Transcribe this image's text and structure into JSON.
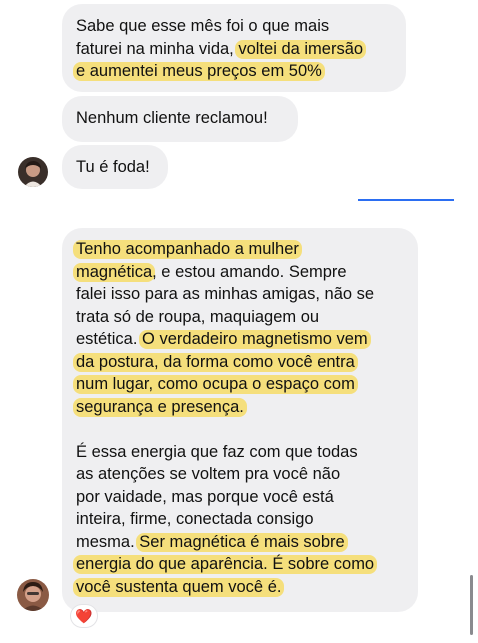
{
  "conversation": {
    "messages_top": [
      {
        "lines": [
          [
            "Sabe que esse mês foi o que mais"
          ],
          [
            "faturei na minha vida, ",
            "voltei da imersão"
          ],
          [
            "e aumentei meus preços em 50%"
          ]
        ]
      },
      {
        "lines": [
          [
            "Nenhum cliente reclamou!"
          ]
        ]
      },
      {
        "lines": [
          [
            "Tu é foda!"
          ]
        ]
      }
    ],
    "long_message": {
      "para1": [
        "Tenho acompanhado a mulher",
        "magnética",
        ", e estou amando. Sempre",
        "falei isso para as minhas amigas, não se",
        "trata só de roupa, maquiagem ou",
        "estética. ",
        "O verdadeiro magnetismo vem",
        "da postura, da forma como você entra",
        "num lugar, como ocupa o espaço com",
        "segurança e presença."
      ],
      "para2": [
        "É essa energia que faz com que todas",
        "as atenções se voltem pra você  não",
        "por vaidade, mas porque você está",
        "inteira, firme, conectada consigo",
        "mesma. ",
        "Ser magnética é mais sobre",
        "energia do que aparência. É sobre como",
        "você sustenta quem você é."
      ]
    },
    "reaction": {
      "emoji": "❤️"
    }
  },
  "colors": {
    "bubble": "#efeff1",
    "highlight": "#f5df7c",
    "link": "#2b6ef2"
  }
}
